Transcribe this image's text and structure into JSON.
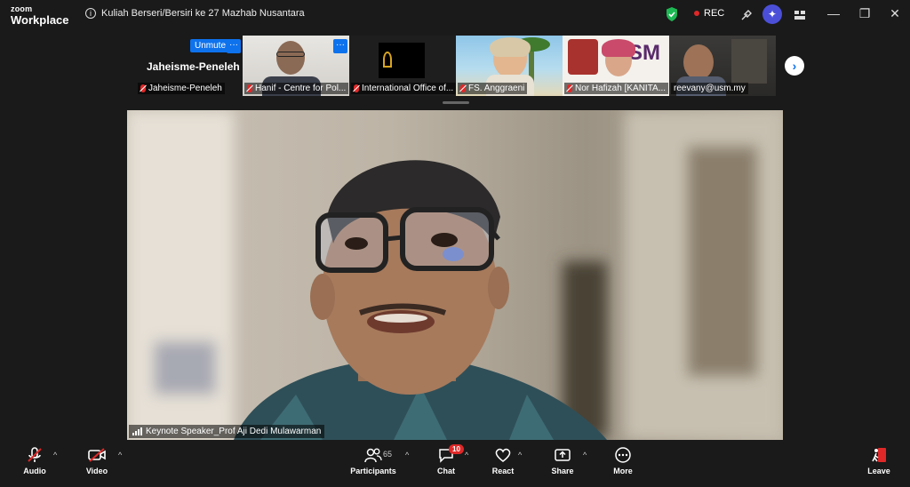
{
  "app": {
    "logo_line1": "zoom",
    "logo_line2": "Workplace"
  },
  "meeting": {
    "title": "Kuliah Berseri/Bersiri ke 27 Mazhab Nusantara",
    "rec_label": "REC"
  },
  "self_view": {
    "name": "Jaheisme-Peneleh",
    "unmute_label": "Unmute",
    "more_label": "···",
    "label": "Jaheisme-Peneleh"
  },
  "thumbnails": [
    {
      "name": "Hanif - Centre for Pol..."
    },
    {
      "name": "International Office of..."
    },
    {
      "name": "FS. Anggraeni"
    },
    {
      "name": "Nor Hafizah [KANITA..."
    },
    {
      "name": "reevany@usm.my"
    }
  ],
  "main_speaker": {
    "name": "Keynote Speaker_Prof Aji Dedi Mulawarman"
  },
  "toolbar": {
    "audio": "Audio",
    "video": "Video",
    "participants": "Participants",
    "participants_count": "65",
    "chat": "Chat",
    "chat_badge": "10",
    "react": "React",
    "share": "Share",
    "more": "More",
    "leave": "Leave"
  },
  "colors": {
    "accent": "#0e72ed",
    "danger": "#e02828",
    "background": "#1a1a1a",
    "ai": "#4b4fd8"
  }
}
